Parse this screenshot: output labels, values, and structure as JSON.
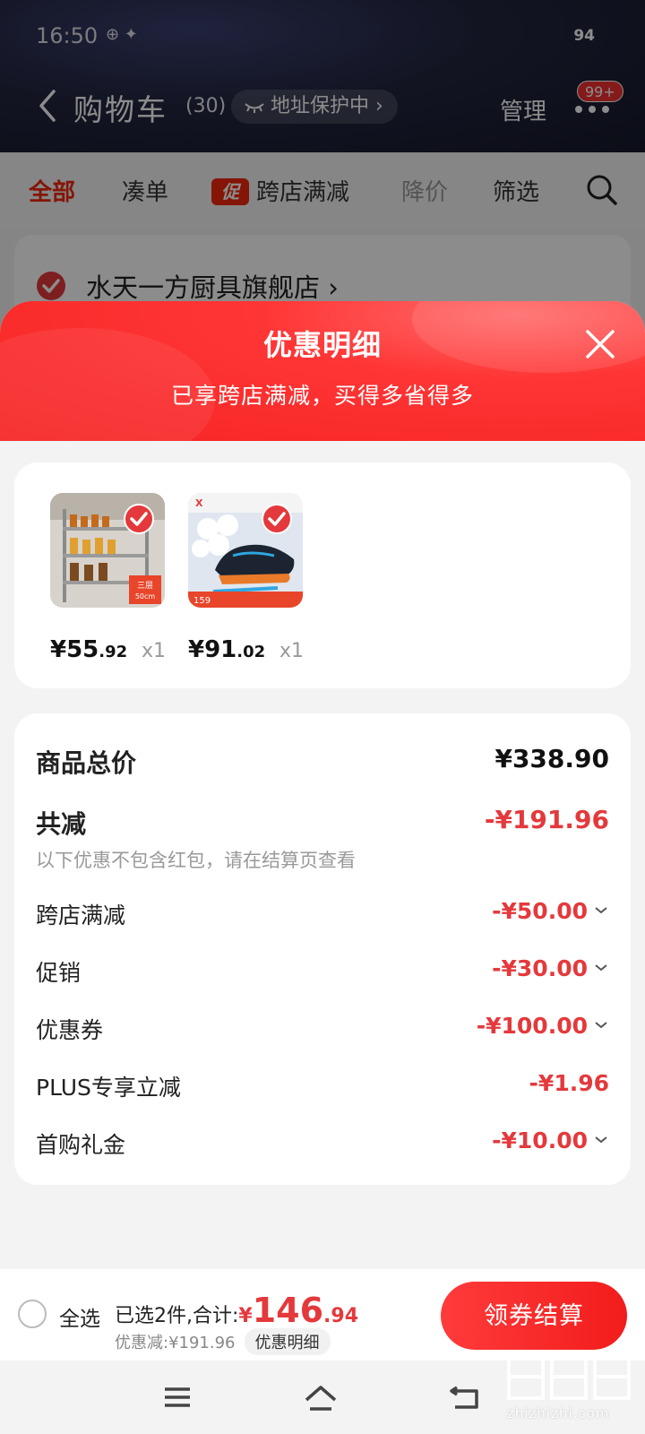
{
  "status_bar": {
    "time": "16:50",
    "icons": "⊕ ✦",
    "battery": "94"
  },
  "header": {
    "title": "购物车",
    "count": "(30)",
    "address_pill": "地址保护中 ›",
    "manage": "管理",
    "badge": "99+"
  },
  "filters": [
    {
      "label": "全部"
    },
    {
      "label": "凑单"
    },
    {
      "promo_tag": "促",
      "label": "跨店满减"
    },
    {
      "label": "降价"
    },
    {
      "label": "筛选"
    }
  ],
  "shop": {
    "name": "水天一方厨具旗舰店 ›"
  },
  "sheet": {
    "title": "优惠明细",
    "subtitle": "已享跨店满减，买得多省得多"
  },
  "products": [
    {
      "price_int": "¥55",
      "price_dec": ".92",
      "qty": "x1",
      "image": "kitchen-rack-image"
    },
    {
      "price_int": "¥91",
      "price_dec": ".02",
      "qty": "x1",
      "image": "running-shoes-image"
    }
  ],
  "breakdown": {
    "total_label": "商品总价",
    "total_value": "¥338.90",
    "reduce_label": "共减",
    "reduce_value": "-¥191.96",
    "note": "以下优惠不包含红包，请在结算页查看",
    "items": [
      {
        "label": "跨店满减",
        "value": "-¥50.00"
      },
      {
        "label": "促销",
        "value": "-¥30.00"
      },
      {
        "label": "优惠券",
        "value": "-¥100.00"
      },
      {
        "label": "PLUS专享立减",
        "value": "-¥1.96"
      },
      {
        "label": "首购礼金",
        "value": "-¥10.00"
      }
    ]
  },
  "checkout": {
    "select_all": "全选",
    "selected_text": "已选2件,合计:",
    "total_cur": "¥",
    "total_int": "146",
    "total_dec": ".94",
    "discount_text": "优惠减:¥191.96",
    "detail_chip": "优惠明细",
    "button": "领券结算"
  },
  "watermark": {
    "text": "zhizhizhi.com"
  },
  "colors": {
    "accent_red": "#e4393c",
    "sheet_red": "#f52424",
    "checkout_red": "#f21c1c"
  }
}
